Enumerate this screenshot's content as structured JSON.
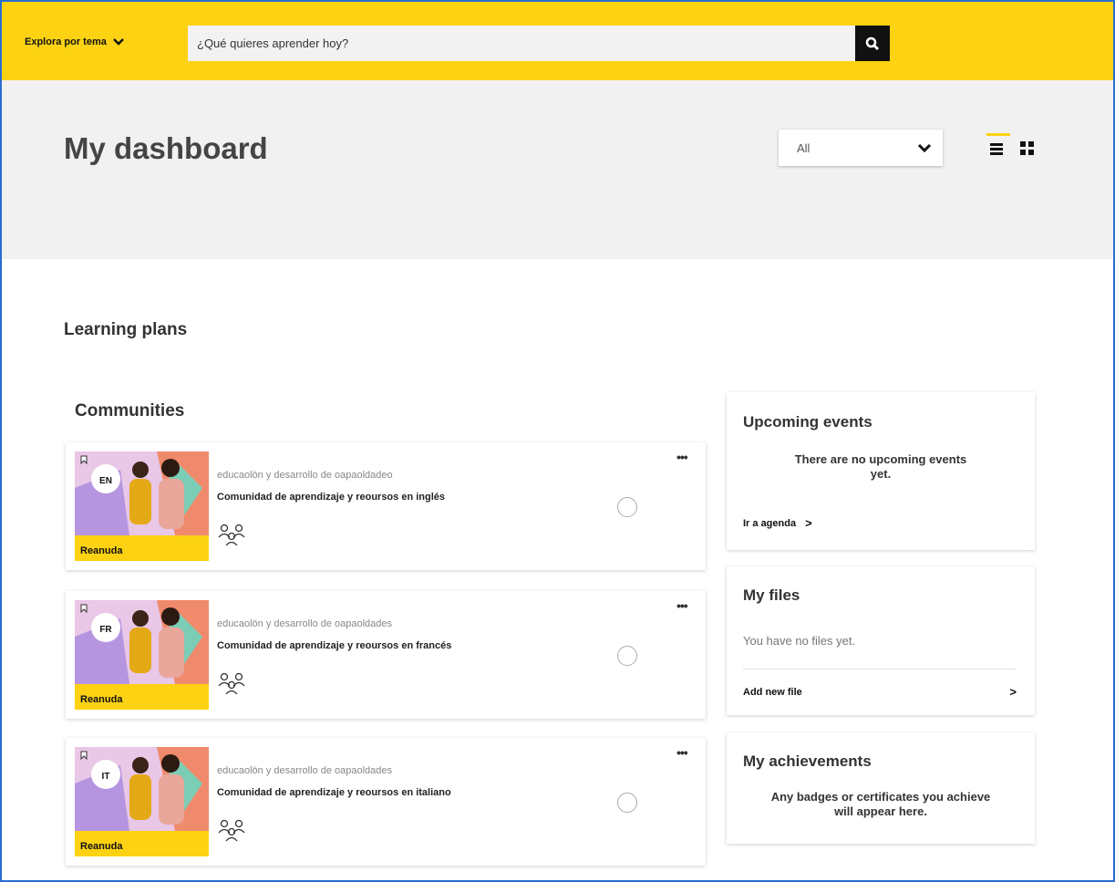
{
  "topbar": {
    "explore_label": "Explora por tema",
    "search_placeholder": "¿Qué quieres aprender hoy?",
    "brand_color": "#fcd213"
  },
  "header": {
    "title": "My dashboard",
    "filter_value": "All"
  },
  "learning_plans": {
    "title": "Learning plans"
  },
  "communities": {
    "title": "Communities",
    "items": [
      {
        "lang": "EN",
        "category": "educaolön y desarrollo de oapaoldadeo",
        "title": "Comunidad de aprendizaje y reoursos en inglés",
        "action": "Reanuda"
      },
      {
        "lang": "FR",
        "category": "educaolön y desarrollo de oapaoldades",
        "title": "Comunidad de aprendizaje y reoursos en francés",
        "action": "Reanuda"
      },
      {
        "lang": "IT",
        "category": "educaolön y desarrollo de oapaoldades",
        "title": "Comunidad de aprendizaje y reoursos en italiano",
        "action": "Reanuda"
      }
    ]
  },
  "widgets": {
    "events": {
      "title": "Upcoming events",
      "empty_line1": "There are no upcoming events",
      "empty_line2": "yet.",
      "link": "Ir a agenda"
    },
    "files": {
      "title": "My files",
      "empty": "You have no files yet.",
      "link": "Add new file"
    },
    "achievements": {
      "title": "My achievements",
      "text_line1": "Any badges or certificates you achieve",
      "text_line2": "will appear here."
    }
  }
}
